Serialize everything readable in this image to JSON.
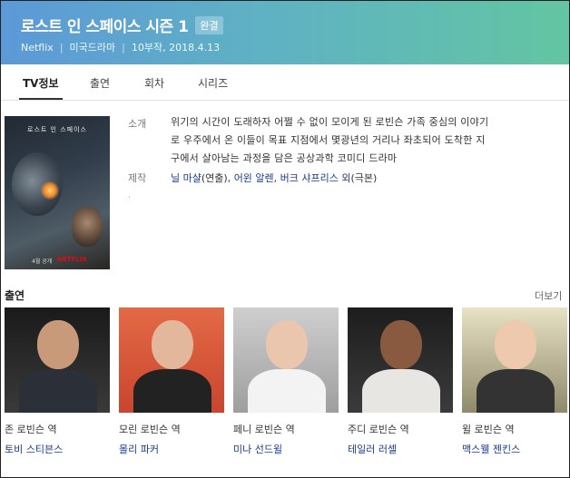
{
  "header": {
    "title": "로스트 인 스페이스 시즌 1",
    "status_badge": "완결",
    "network": "Netflix",
    "genre": "미국드라마",
    "episodes_date": "10부작, 2018.4.13"
  },
  "tabs": [
    {
      "label": "TV정보",
      "active": true
    },
    {
      "label": "출연",
      "active": false
    },
    {
      "label": "회차",
      "active": false
    },
    {
      "label": "시리즈",
      "active": false
    }
  ],
  "poster": {
    "title": "로스트 인 스페이스",
    "date": "4월 공개",
    "brand": "NETFLIX"
  },
  "info": {
    "summary_label": "소개",
    "summary_lines": [
      "위기의 시간이 도래하자 어쩔 수 없이 모이게 된 로빈슨 가족 중심의 이야기",
      "로 우주에서 온 이들이 목표 지점에서 몇광년의 거리나 좌초되어 도착한 지",
      "구에서 살아남는 과정을 담은 공상과학 코미디 드라마"
    ],
    "production_label": "제작",
    "production": {
      "director": "닐 마샬",
      "director_role": "(연출),",
      "writer1": "어윈 알렌",
      "comma": ",",
      "writer2": "버크 샤프리스 외",
      "writer_role": "(극본)"
    },
    "dot": "·"
  },
  "cast_section": {
    "title": "출연",
    "more": "더보기",
    "items": [
      {
        "role": "존 로빈슨 역",
        "actor": "토비 스티븐스"
      },
      {
        "role": "모린 로빈슨 역",
        "actor": "몰리 파커"
      },
      {
        "role": "페니 로빈슨 역",
        "actor": "미나 선드윌"
      },
      {
        "role": "주디 로빈슨 역",
        "actor": "테일러 러셀"
      },
      {
        "role": "윌 로빈슨 역",
        "actor": "맥스웰 젠킨스"
      }
    ]
  },
  "colors": {
    "header_start": "#5c99d8",
    "header_end": "#63c5a2",
    "link": "#1a3b8a",
    "netflix_red": "#e50914"
  }
}
